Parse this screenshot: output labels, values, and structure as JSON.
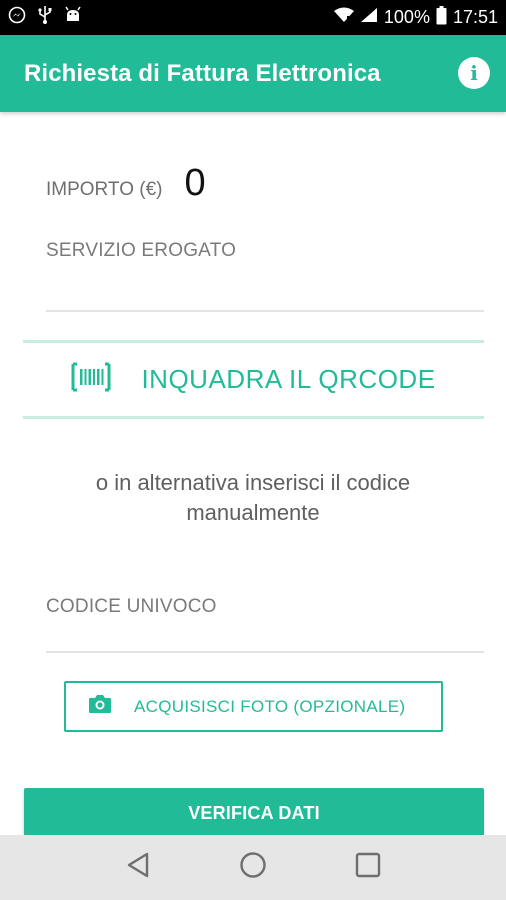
{
  "status_bar": {
    "battery": "100%",
    "time": "17:51",
    "icons": [
      "messenger-icon",
      "usb-icon",
      "android-debug-icon",
      "wifi-icon",
      "signal-icon",
      "battery-icon"
    ]
  },
  "app_bar": {
    "title": "Richiesta di Fattura Elettronica",
    "info_icon": "info-icon"
  },
  "form": {
    "amount_label": "IMPORTO (€)",
    "amount_value": "0",
    "service_label": "SERVIZIO EROGATO",
    "qr_label": "INQUADRA IL QRCODE",
    "qr_icon": "barcode-icon",
    "alternative_text": "o in alternativa inserisci il codice manualmente",
    "code_label": "CODICE UNIVOCO",
    "photo_button_label": "ACQUISISCI FOTO (OPZIONALE)",
    "photo_icon": "camera-icon",
    "verify_button_label": "VERIFICA DATI"
  },
  "nav_bar": {
    "buttons": [
      "back-icon",
      "home-icon",
      "recents-icon"
    ]
  },
  "colors": {
    "accent": "#22bb98",
    "divider": "#c8ece2"
  }
}
